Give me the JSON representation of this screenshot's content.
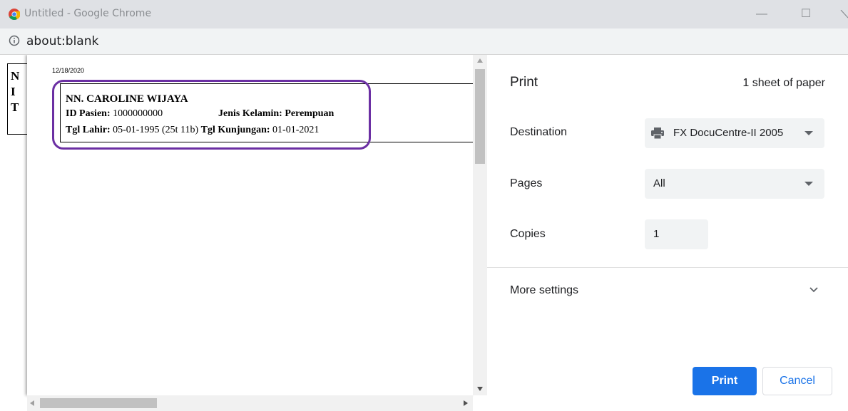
{
  "window": {
    "title": "Untitled - Google Chrome",
    "minimize_glyph": "—",
    "maximize_glyph": "☐"
  },
  "address": {
    "url": "about:blank"
  },
  "preview": {
    "bg_letters": [
      "N",
      "I",
      "T"
    ],
    "date": "12/18/2020",
    "card": {
      "name": "NN. CAROLINE WIJAYA",
      "id_label": "ID Pasien:",
      "id_value": "1000000000",
      "gender_label": "Jenis Kelamin:",
      "gender_value": "Perempuan",
      "dob_label": "Tgl Lahir:",
      "dob_value": "05-01-1995 (25t 11b)",
      "visit_label": "Tgl Kunjungan:",
      "visit_value": "01-01-2021"
    },
    "highlight_color": "#6b2fa3"
  },
  "print": {
    "title": "Print",
    "sheets": "1 sheet of paper",
    "destination_label": "Destination",
    "destination_value": "FX DocuCentre-II 2005",
    "pages_label": "Pages",
    "pages_value": "All",
    "copies_label": "Copies",
    "copies_value": "1",
    "more_settings_label": "More settings",
    "print_button": "Print",
    "cancel_button": "Cancel",
    "accent_color": "#1a73e8"
  }
}
